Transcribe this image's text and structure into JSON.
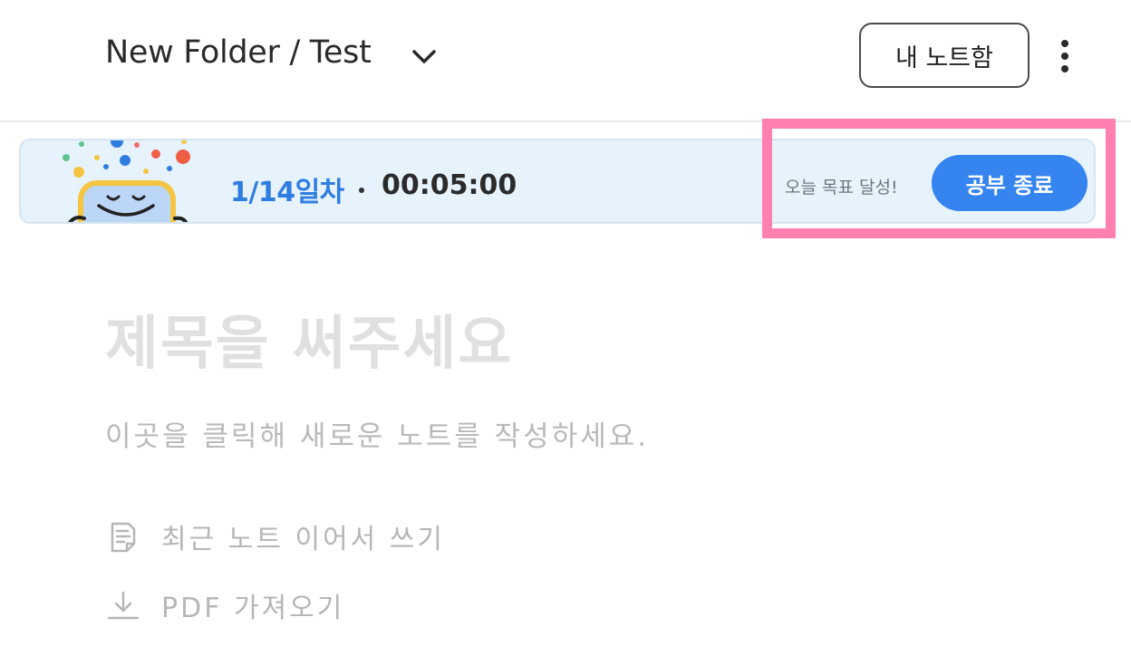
{
  "header": {
    "breadcrumb": "New Folder / Test",
    "notebox_button": "내 노트함",
    "chevron_icon": "chevron-down-icon",
    "more_icon": "more-vertical-icon"
  },
  "study_banner": {
    "day_counter": "1/14일차",
    "timer": "00:05:00",
    "goal_text": "오늘 목표 달성!",
    "end_button": "공부 종료",
    "accent_color": "#3584f0",
    "highlight_color": "#ff7fb0"
  },
  "editor": {
    "title_placeholder": "제목을 써주세요",
    "body_placeholder": "이곳을 클릭해 새로운 노트를 작성하세요."
  },
  "actions": [
    {
      "label": "최근 노트 이어서 쓰기",
      "icon": "note-icon"
    },
    {
      "label": "PDF 가져오기",
      "icon": "download-icon"
    }
  ]
}
